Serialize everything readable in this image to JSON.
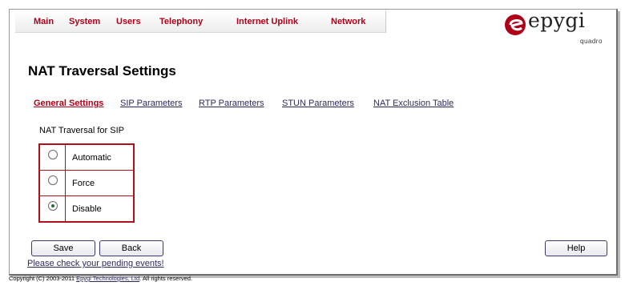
{
  "nav": {
    "items": [
      "Main",
      "System",
      "Users",
      "Telephony",
      "Internet Uplink",
      "Network"
    ]
  },
  "logo": {
    "brand": "epygi",
    "sub": "quadro"
  },
  "page": {
    "title": "NAT Traversal Settings"
  },
  "tabs": [
    {
      "label": "General Settings",
      "active": true
    },
    {
      "label": "SIP Parameters",
      "active": false
    },
    {
      "label": "RTP Parameters",
      "active": false
    },
    {
      "label": "STUN Parameters",
      "active": false
    },
    {
      "label": "NAT Exclusion Table",
      "active": false
    }
  ],
  "section": {
    "label": "NAT Traversal for SIP",
    "options": [
      {
        "label": "Automatic",
        "selected": false
      },
      {
        "label": "Force",
        "selected": false
      },
      {
        "label": "Disable",
        "selected": true
      }
    ]
  },
  "buttons": {
    "save": "Save",
    "back": "Back",
    "help": "Help"
  },
  "footer": {
    "pending_link": "Please check your pending events!",
    "copyright_pre": "Copyright (C) 2003-2011 ",
    "copyright_link": "Epygi Technologies, Ltd",
    "copyright_post": ". All rights reserved."
  },
  "colors": {
    "accent": "#b00018",
    "link": "#2b2b5a"
  }
}
